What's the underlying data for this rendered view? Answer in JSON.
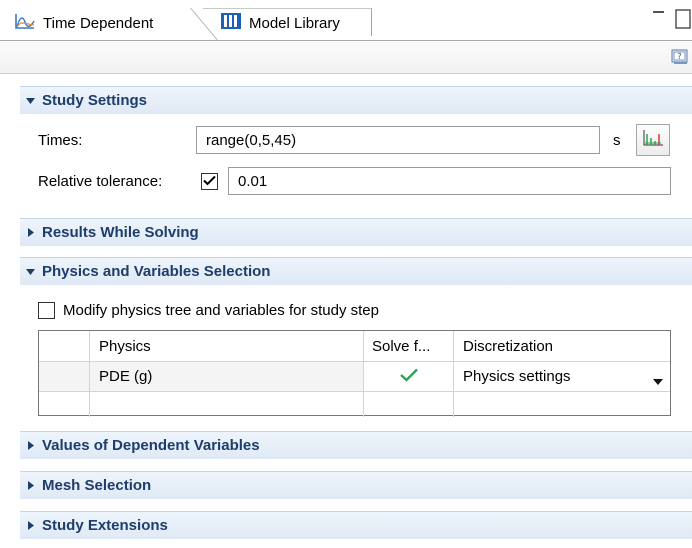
{
  "tabs": [
    {
      "label": "Time Dependent",
      "icon": "time-dependent-icon",
      "active": true
    },
    {
      "label": "Model Library",
      "icon": "model-library-icon",
      "active": false
    }
  ],
  "toolbar": {
    "help_icon": "help-icon"
  },
  "sections": {
    "study_settings": "Study Settings",
    "results_while_solving": "Results While Solving",
    "physics_variables": "Physics and Variables Selection",
    "values_dependent": "Values of Dependent Variables",
    "mesh_selection": "Mesh Selection",
    "study_extensions": "Study Extensions"
  },
  "study": {
    "times_label": "Times:",
    "times_value": "range(0,5,45)",
    "times_unit": "s",
    "rel_tol_label": "Relative tolerance:",
    "rel_tol_checked": true,
    "rel_tol_value": "0.01"
  },
  "physics": {
    "modify_label": "Modify physics tree and variables for study step",
    "modify_checked": false,
    "columns": [
      "Physics",
      "Solve f...",
      "Discretization"
    ],
    "rows": [
      {
        "physics": "PDE (g)",
        "solve": true,
        "discretization": "Physics settings"
      }
    ]
  },
  "colors": {
    "section_text": "#1d3d6b",
    "check_green": "#2ea44f"
  }
}
